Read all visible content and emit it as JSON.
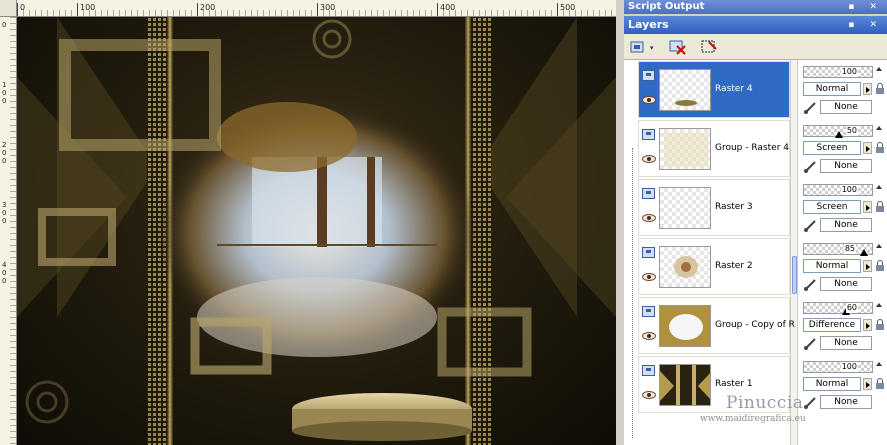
{
  "ruler": {
    "top_numbers": [
      "0",
      "100",
      "200",
      "300",
      "400",
      "500"
    ],
    "left_numbers": [
      "0",
      "100",
      "200",
      "300",
      "400"
    ]
  },
  "panels": {
    "script_output_title": "Script Output",
    "layers_title": "Layers"
  },
  "layers": [
    {
      "name": "Raster 4",
      "opacity": "100",
      "opacity_marker": "",
      "blend": "Normal",
      "mask": "None",
      "selected": true
    },
    {
      "name": "Group - Raster 4",
      "opacity": "50",
      "opacity_marker": "50",
      "blend": "Screen",
      "mask": "None",
      "selected": false
    },
    {
      "name": "Raster 3",
      "opacity": "100",
      "opacity_marker": "",
      "blend": "Screen",
      "mask": "None",
      "selected": false
    },
    {
      "name": "Raster 2",
      "opacity": "85",
      "opacity_marker": "85",
      "blend": "Normal",
      "mask": "None",
      "selected": false
    },
    {
      "name": "Group - Copy of R",
      "opacity": "60",
      "opacity_marker": "60",
      "blend": "Difference",
      "mask": "None",
      "selected": false
    },
    {
      "name": "Raster 1",
      "opacity": "100",
      "opacity_marker": "",
      "blend": "Normal",
      "mask": "None",
      "selected": false
    }
  ],
  "watermark": {
    "name": "Pinuccia",
    "url": "www.maidiregrafica.eu"
  },
  "colors": {
    "selection": "#316ac5",
    "title_bar": "#2f5fc2",
    "canvas_gold": "#b59a52"
  },
  "icons": {
    "toolbar": [
      "new-layer-icon",
      "delete-layer-icon",
      "edit-selection-icon"
    ]
  }
}
